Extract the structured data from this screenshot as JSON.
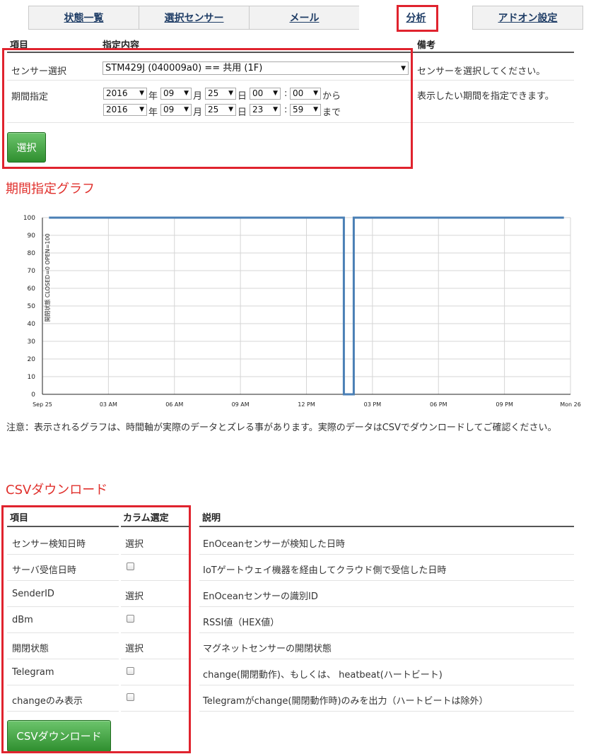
{
  "tabs": [
    {
      "label": "状態一覧",
      "active": false
    },
    {
      "label": "選択センサー",
      "active": false
    },
    {
      "label": "メール",
      "active": false
    },
    {
      "label": "分析",
      "active": true
    },
    {
      "label": "アドオン設定",
      "active": false
    }
  ],
  "filter": {
    "headers": {
      "item": "項目",
      "content": "指定内容",
      "note": "備考"
    },
    "sensor_row": {
      "label": "センサー選択",
      "selected": "STM429J (040009a0) == 共用 (1F)",
      "note": "センサーを選択してください。"
    },
    "period_row": {
      "label": "期間指定",
      "note": "表示したい期間を指定できます。",
      "from": {
        "year": "2016",
        "month": "09",
        "day": "25",
        "hour": "00",
        "minute": "00",
        "suffix": "から"
      },
      "to": {
        "year": "2016",
        "month": "09",
        "day": "25",
        "hour": "23",
        "minute": "59",
        "suffix": "まで"
      },
      "unit_year": "年",
      "unit_month": "月",
      "unit_day": "日",
      "unit_colon": ":"
    },
    "select_button": "選択"
  },
  "graph_section": {
    "title": "期間指定グラフ",
    "note": "注意：表示されるグラフは、時間軸が実際のデータとズレる事があります。実際のデータはCSVでダウンロードしてご確認ください。"
  },
  "chart_data": {
    "type": "line",
    "ylabel": "開閉状態 CLOSED=0 OPEN=100",
    "xlabel": "",
    "ylim": [
      0,
      100
    ],
    "yticks": [
      0,
      10,
      20,
      30,
      40,
      50,
      60,
      70,
      80,
      90,
      100
    ],
    "xlim": [
      0,
      24
    ],
    "xticks": [
      {
        "v": 0,
        "label": "Sep 25"
      },
      {
        "v": 3,
        "label": "03 AM"
      },
      {
        "v": 6,
        "label": "06 AM"
      },
      {
        "v": 9,
        "label": "09 AM"
      },
      {
        "v": 12,
        "label": "12 PM"
      },
      {
        "v": 15,
        "label": "03 PM"
      },
      {
        "v": 18,
        "label": "06 PM"
      },
      {
        "v": 21,
        "label": "09 PM"
      },
      {
        "v": 24,
        "label": "Mon 26"
      }
    ],
    "grid": true,
    "series": [
      {
        "points": [
          [
            0.3,
            100
          ],
          [
            13.7,
            100
          ],
          [
            13.7,
            0
          ],
          [
            14.15,
            0
          ],
          [
            14.15,
            100
          ],
          [
            23.7,
            100
          ]
        ],
        "color": "#4a7fb5"
      }
    ]
  },
  "csv_section": {
    "title": "CSVダウンロード",
    "headers": {
      "item": "項目",
      "column": "カラム選定",
      "desc": "説明"
    },
    "rows": [
      {
        "item": "センサー検知日時",
        "column": "選択",
        "checkbox": false,
        "desc": "EnOceanセンサーが検知した日時"
      },
      {
        "item": "サーバ受信日時",
        "column": "",
        "checkbox": true,
        "desc": "IoTゲートウェイ機器を経由してクラウド側で受信した日時"
      },
      {
        "item": "SenderID",
        "column": "選択",
        "checkbox": false,
        "desc": "EnOceanセンサーの識別ID"
      },
      {
        "item": "dBm",
        "column": "",
        "checkbox": true,
        "desc": "RSSI値（HEX値）"
      },
      {
        "item": "開閉状態",
        "column": "選択",
        "checkbox": false,
        "desc": "マグネットセンサーの開閉状態"
      },
      {
        "item": "Telegram",
        "column": "",
        "checkbox": true,
        "desc": "change(開閉動作)、もしくは、 heatbeat(ハートビート)"
      },
      {
        "item": "changeのみ表示",
        "column": "",
        "checkbox": true,
        "desc": "Telegramがchange(開閉動作時)のみを出力（ハートビートは除外）"
      }
    ],
    "download_button": "CSVダウンロード"
  },
  "colors": {
    "accent_red": "#e0232e",
    "button_green": "#3c9a3c",
    "line_blue": "#4a7fb5"
  }
}
